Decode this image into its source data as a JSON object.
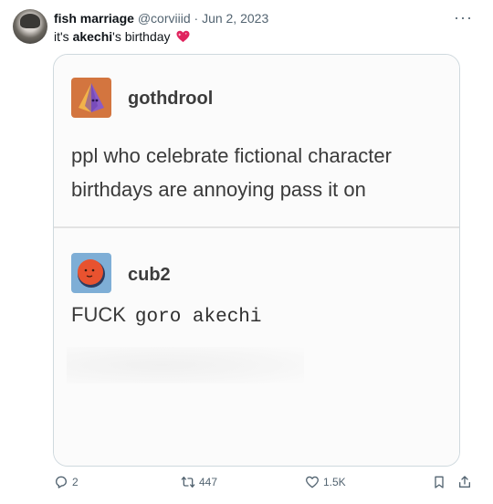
{
  "tweet": {
    "display_name": "fish marriage",
    "handle": "@corviiid",
    "separator": "·",
    "date": "Jun 2, 2023",
    "text_before": "it's ",
    "text_bold": "akechi",
    "text_after": "'s birthday",
    "emoji": "heart-emoji"
  },
  "screenshot": {
    "post_1": {
      "username": "gothdrool",
      "text": "ppl who celebrate fictional character birthdays are annoying pass it on"
    },
    "post_2": {
      "username": "cub2",
      "text_printed": "FUCK",
      "text_typed": "goro akechi"
    }
  },
  "actions": {
    "reply_count": "2",
    "retweet_count": "447",
    "like_count": "1.5K"
  },
  "colors": {
    "secondary_text": "#536471",
    "heart": "#e0245e",
    "gothdrool_avatar": "#d3753f",
    "cub2_avatar": "#7eaed6"
  }
}
